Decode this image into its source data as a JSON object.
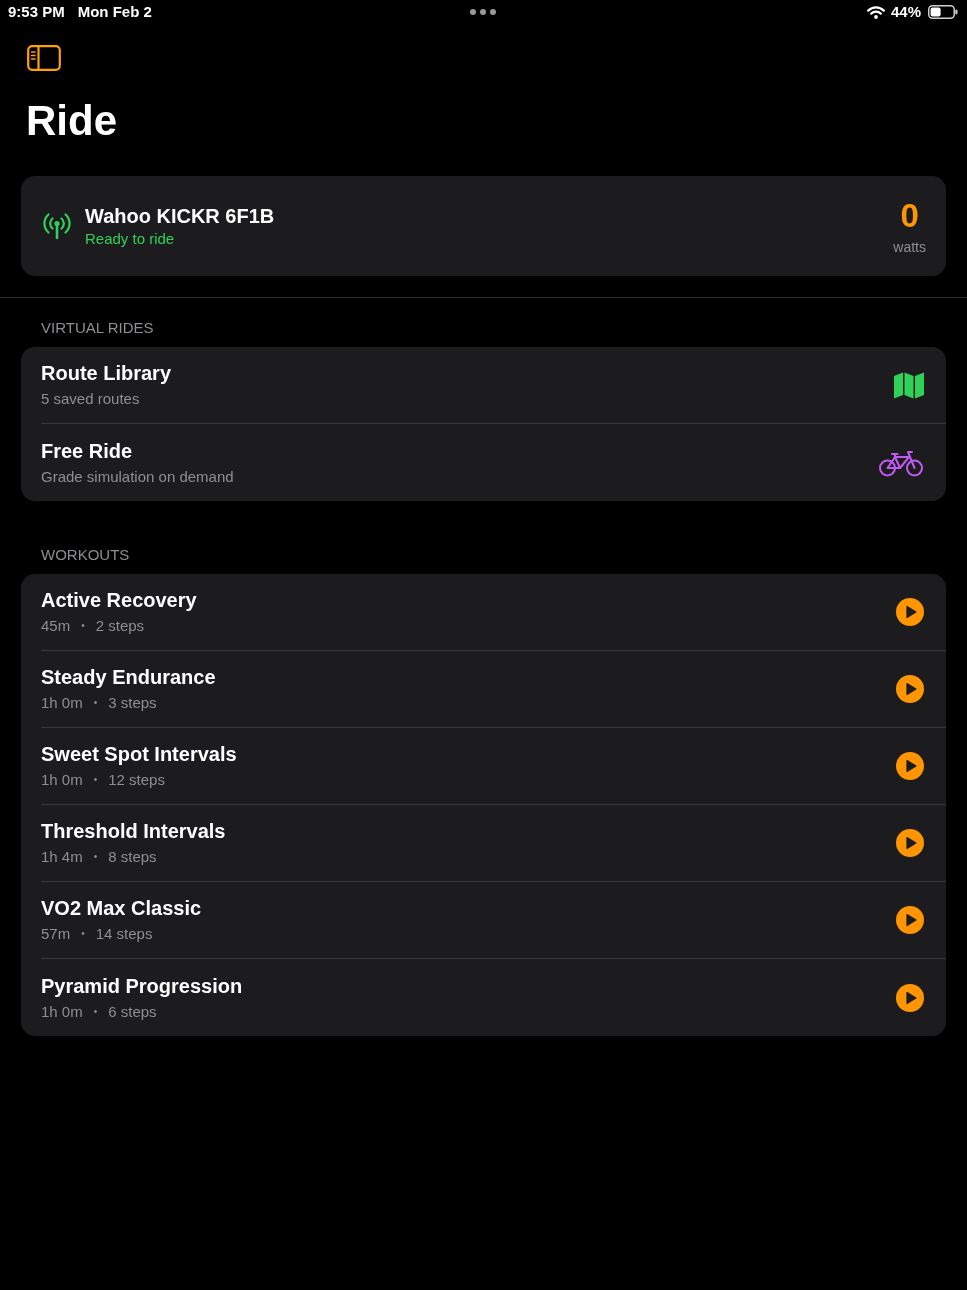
{
  "status_bar": {
    "time": "9:53 PM",
    "date": "Mon Feb 2",
    "battery": "44%"
  },
  "title": "Ride",
  "trainer": {
    "name": "Wahoo KICKR 6F1B",
    "status": "Ready to ride",
    "connected": true,
    "power": "0",
    "power_unit": "watts"
  },
  "sections": [
    {
      "header": "VIRTUAL RIDES",
      "items": [
        {
          "kind": "library",
          "title": "Route Library",
          "subtitle": "5 saved routes",
          "color": "#30d158"
        },
        {
          "kind": "freeride",
          "title": "Free Ride",
          "subtitle": "Grade simulation on demand",
          "color": "#bf5af2"
        }
      ]
    },
    {
      "header": "WORKOUTS",
      "items": [
        {
          "kind": "workout",
          "title": "Active Recovery",
          "duration": "45m",
          "separator": "•",
          "steps": "2 steps"
        },
        {
          "kind": "workout",
          "title": "Steady Endurance",
          "duration": "1h 0m",
          "separator": "•",
          "steps": "3 steps"
        },
        {
          "kind": "workout",
          "title": "Sweet Spot Intervals",
          "duration": "1h 0m",
          "separator": "•",
          "steps": "12 steps"
        },
        {
          "kind": "workout",
          "title": "Threshold Intervals",
          "duration": "1h 4m",
          "separator": "•",
          "steps": "8 steps"
        },
        {
          "kind": "workout",
          "title": "VO2 Max Classic",
          "duration": "57m",
          "separator": "•",
          "steps": "14 steps"
        },
        {
          "kind": "workout",
          "title": "Pyramid Progression",
          "duration": "1h 0m",
          "separator": "•",
          "steps": "6 steps"
        }
      ]
    }
  ]
}
